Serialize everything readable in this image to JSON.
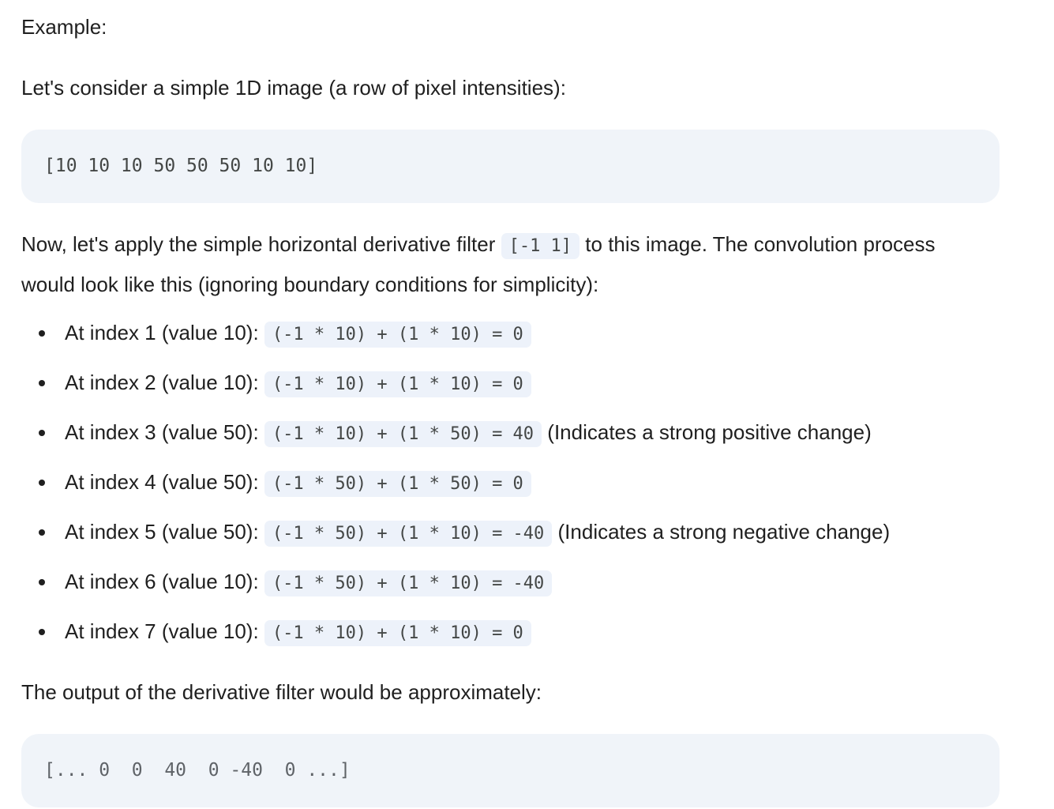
{
  "heading": "Example:",
  "intro": "Let's consider a simple 1D image (a row of pixel intensities):",
  "image_code": "[10 10 10 50 50 50 10 10]",
  "filter_para": {
    "before": "Now, let's apply the simple horizontal derivative filter ",
    "code": "[-1 1]",
    "after": " to this image. The convolution process would look like this (ignoring boundary conditions for simplicity):"
  },
  "steps": [
    {
      "label": "At index 1 (value 10): ",
      "code": "(-1 * 10) + (1 * 10) = 0",
      "note": ""
    },
    {
      "label": "At index 2 (value 10): ",
      "code": "(-1 * 10) + (1 * 10) = 0",
      "note": ""
    },
    {
      "label": "At index 3 (value 50): ",
      "code": "(-1 * 10) + (1 * 50) = 40",
      "note": " (Indicates a strong positive change)"
    },
    {
      "label": "At index 4 (value 50): ",
      "code": "(-1 * 50) + (1 * 50) = 0",
      "note": ""
    },
    {
      "label": "At index 5 (value 50): ",
      "code": "(-1 * 50) + (1 * 10) = -40",
      "note": " (Indicates a strong negative change)"
    },
    {
      "label": "At index 6 (value 10): ",
      "code": "(-1 * 50) + (1 * 10) = -40",
      "note": ""
    },
    {
      "label": "At index 7 (value 10): ",
      "code": "(-1 * 10) + (1 * 10) = 0",
      "note": ""
    }
  ],
  "output_intro": "The output of the derivative filter would be approximately:",
  "output_code": "[... 0  0  40  0 -40  0 ...]"
}
